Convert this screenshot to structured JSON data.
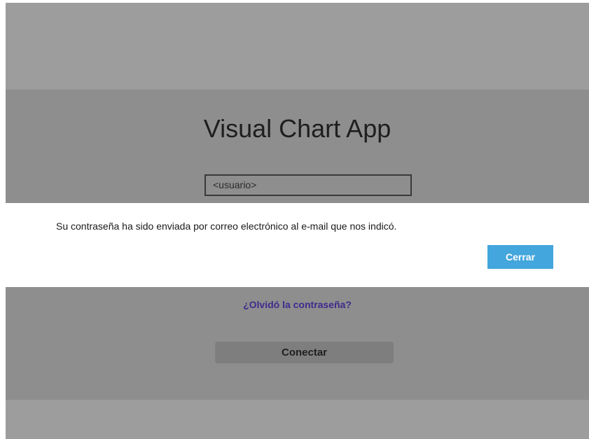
{
  "app": {
    "title": "Visual Chart App"
  },
  "login": {
    "username_placeholder": "<usuario>",
    "forgot_password_label": "¿Olvidó la contraseña?",
    "connect_label": "Conectar"
  },
  "dialog": {
    "message": "Su contraseña ha sido enviada por correo electrónico al e-mail que nos indicó.",
    "close_label": "Cerrar"
  },
  "colors": {
    "overlay_background": "#9d9d9d",
    "panel_background": "#8e8e8e",
    "dialog_background": "#ffffff",
    "accent_button": "#43a6dc",
    "link": "#3f2a8c"
  }
}
